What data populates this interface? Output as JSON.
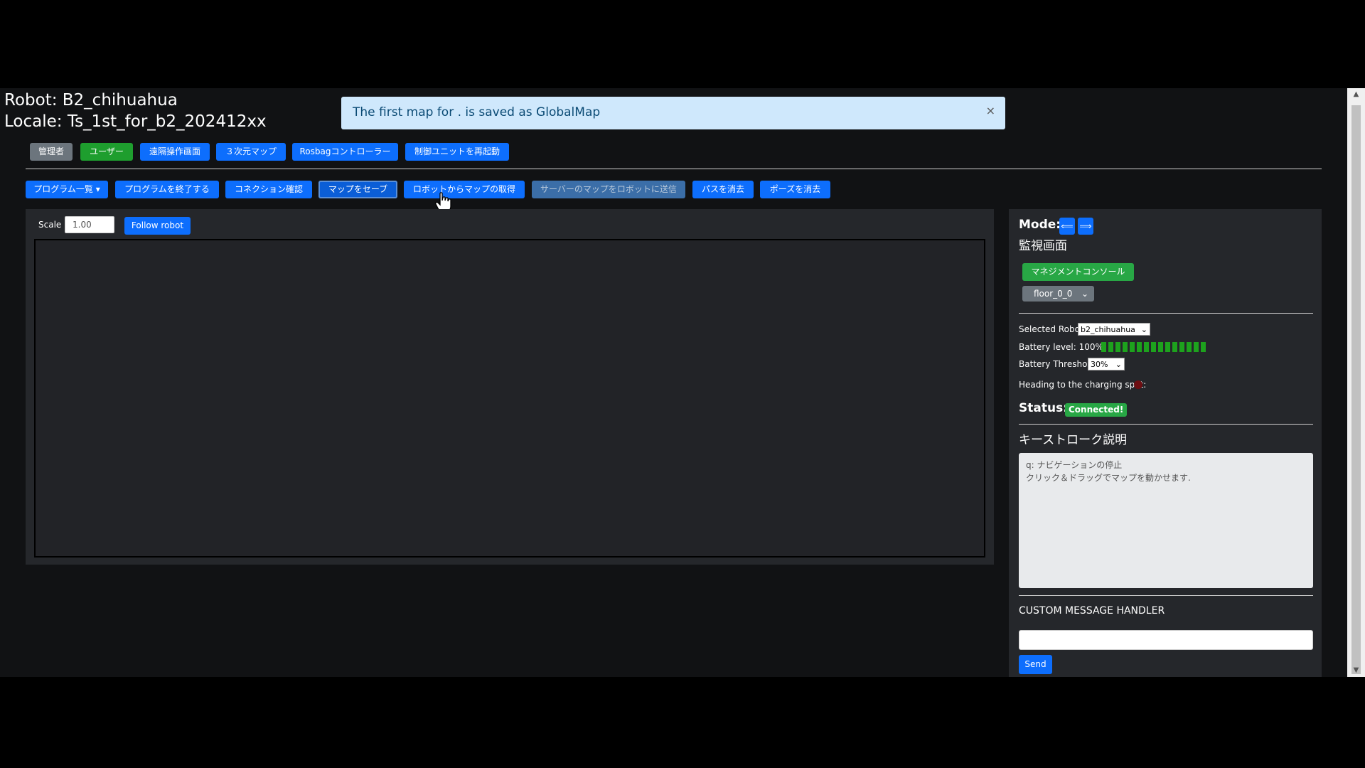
{
  "header": {
    "robot": "Robot: B2_chihuahua",
    "locale": "Locale: Ts_1st_for_b2_202412xx"
  },
  "alert": {
    "message": "The first map for . is saved as GlobalMap",
    "close": "×"
  },
  "nav_buttons": [
    "管理者",
    "ユーザー",
    "遠隔操作画面",
    "３次元マップ",
    "Rosbagコントローラー",
    "制御ユニットを再起動"
  ],
  "action_buttons": [
    "プログラム一覧 ▾",
    "プログラムを終了する",
    "コネクション確認",
    "マップをセーブ",
    "ロボットからマップの取得",
    "サーバーのマップをロボットに送信",
    "パスを消去",
    "ポーズを消去"
  ],
  "map": {
    "scale_label": "Scale",
    "scale_value": "1.00",
    "follow_label": "Follow robot"
  },
  "right": {
    "mode_label": "Mode:",
    "mode_prev": "⟸",
    "mode_next": "⟹",
    "screen_title": "監視画面",
    "management_console": "マネジメントコンソール",
    "floor_select": "floor_0_0",
    "selected_robot_label": "Selected Robot",
    "selected_robot_value": "b2_chihuahua",
    "battery_label": "Battery level: 100%",
    "battery_level": 1.0,
    "battery_threshold_label": "Battery Threshold:",
    "battery_threshold_value": "30%",
    "charging_label": "Heading to the charging spot:",
    "status_label": "Status:",
    "status_value": "Connected!",
    "keystroke_title": "キーストローク説明",
    "keystroke_text_1": "q: ナビゲーションの停止",
    "keystroke_text_2": "クリック＆ドラッグでマップを動かせます.",
    "custom_handler_label": "CUSTOM MESSAGE HANDLER",
    "send_label": "Send"
  },
  "colors": {
    "accent": "#0d6efd",
    "success": "#1e9e2e",
    "alert_bg": "#cfe8fc"
  }
}
